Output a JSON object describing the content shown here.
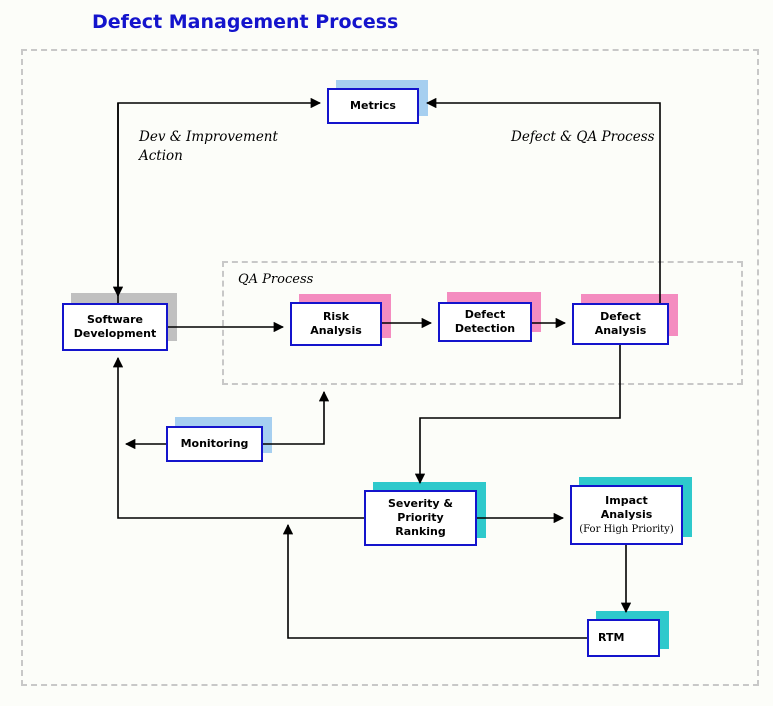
{
  "page": {
    "title": "Defect Management Process",
    "title_color": "#1414cc"
  },
  "regions": [
    {
      "id": "outer",
      "label": ""
    },
    {
      "id": "qa",
      "label": "QA Process"
    }
  ],
  "edge_labels": {
    "dev_improvement": "Dev & Improvement\nAction",
    "defect_qa": "Defect & QA Process"
  },
  "nodes": {
    "metrics": {
      "label": "Metrics",
      "shadow_color": "#a6cff0",
      "border_color": "#1414cc"
    },
    "software": {
      "label": "Software\nDevelopment",
      "shadow_color": "#c0c0c0",
      "border_color": "#1414cc"
    },
    "risk": {
      "label": "Risk\nAnalysis",
      "shadow_color": "#f48cc0",
      "border_color": "#1414cc"
    },
    "detection": {
      "label": "Defect\nDetection",
      "shadow_color": "#f48cc0",
      "border_color": "#1414cc"
    },
    "defect": {
      "label": "Defect\nAnalysis",
      "shadow_color": "#f48cc0",
      "border_color": "#1414cc"
    },
    "monitoring": {
      "label": "Monitoring",
      "shadow_color": "#a6cff0",
      "border_color": "#1414cc"
    },
    "severity": {
      "label": "Severity &\nPriority\nRanking",
      "shadow_color": "#2ec9cc",
      "border_color": "#1414cc"
    },
    "impact": {
      "label": "Impact\nAnalysis",
      "sublabel": "(For High Priority)",
      "shadow_color": "#2ec9cc",
      "border_color": "#1414cc"
    },
    "rtm": {
      "label": "RTM",
      "shadow_color": "#2ec9cc",
      "border_color": "#1414cc"
    }
  },
  "connections": [
    {
      "from": "software",
      "to": "metrics",
      "label": "Dev & Improvement Action"
    },
    {
      "from": "defect",
      "to": "metrics",
      "label": "Defect & QA Process"
    },
    {
      "from": "metrics",
      "to": "software",
      "label": ""
    },
    {
      "from": "software",
      "to": "risk",
      "label": ""
    },
    {
      "from": "risk",
      "to": "detection",
      "label": ""
    },
    {
      "from": "detection",
      "to": "defect",
      "label": ""
    },
    {
      "from": "defect",
      "to": "severity",
      "label": ""
    },
    {
      "from": "severity",
      "to": "impact",
      "label": ""
    },
    {
      "from": "impact",
      "to": "rtm",
      "label": ""
    },
    {
      "from": "rtm",
      "to": "severity",
      "label": ""
    },
    {
      "from": "severity",
      "to": "software",
      "label": ""
    },
    {
      "from": "monitoring",
      "to": "software",
      "label": ""
    },
    {
      "from": "monitoring",
      "to": "qa-region",
      "label": ""
    }
  ]
}
